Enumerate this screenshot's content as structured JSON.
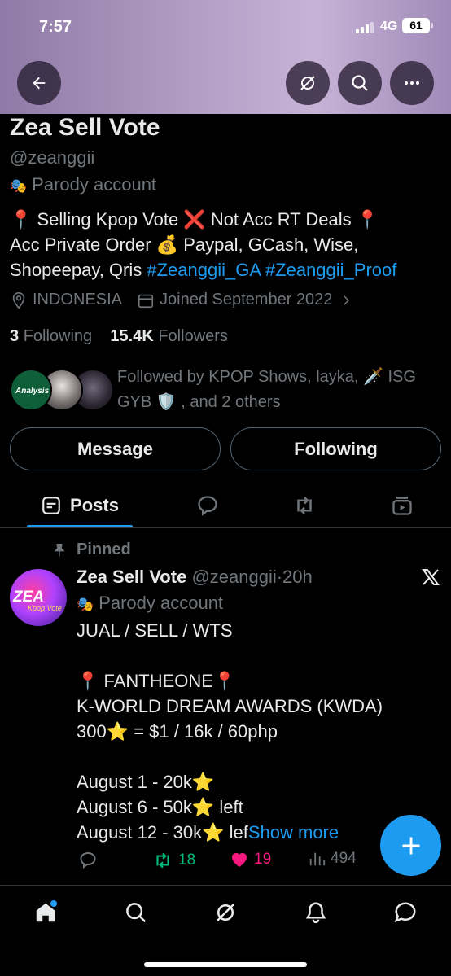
{
  "status_bar": {
    "time": "7:57",
    "network": "4G",
    "battery": "61"
  },
  "header": {
    "back_icon": "arrow-left-icon",
    "grok_icon": "grok-icon",
    "search_icon": "search-icon",
    "more_icon": "more-horizontal-icon"
  },
  "profile": {
    "name": "Zea Sell Vote",
    "handle": "@zeanggii",
    "parody_label": "Parody account",
    "bio_line1": "📍 Selling Kpop Vote ❌ Not Acc RT Deals 📍",
    "bio_line2": "Acc Private Order 💰 Paypal, GCash, Wise,",
    "bio_line3_text": "Shopeepay, Qris ",
    "bio_hashtag1": "#Zeanggii_GA",
    "bio_hashtag2": "#Zeanggii_Proof",
    "location": "INDONESIA",
    "joined": "Joined September 2022",
    "following_count": "3",
    "following_label": "Following",
    "followers_count": "15.4K",
    "followers_label": "Followers",
    "followed_by_line1": "Followed by KPOP Shows, layka, 🗡️ ISG",
    "followed_by_line2": "GYB 🛡️ , and 2 others",
    "avatar_badge_text": "Analysis"
  },
  "buttons": {
    "message": "Message",
    "following": "Following"
  },
  "tabs": {
    "posts": "Posts"
  },
  "post": {
    "pinned_label": "Pinned",
    "author_name": "Zea Sell Vote",
    "author_handle": "@zeanggii",
    "time": "·20h",
    "parody_label": "Parody account",
    "avatar_text": "ZEA",
    "avatar_subtext": "Kpop Vote",
    "lines": [
      "JUAL / SELL / WTS",
      "",
      "📍 FANTHEONE📍",
      "K-WORLD DREAM AWARDS (KWDA)",
      "300⭐ = $1 / 16k / 60php",
      "",
      "August 1 - 20k⭐",
      "August 6 - 50k⭐ left"
    ],
    "last_line": "August 12 - 30k⭐ lef",
    "show_more": "Show more",
    "retweets": "18",
    "likes": "19",
    "views": "494"
  },
  "colors": {
    "accent": "#1d9bf0",
    "retweet": "#00ba7c",
    "like": "#f91880",
    "muted": "#71767b"
  }
}
